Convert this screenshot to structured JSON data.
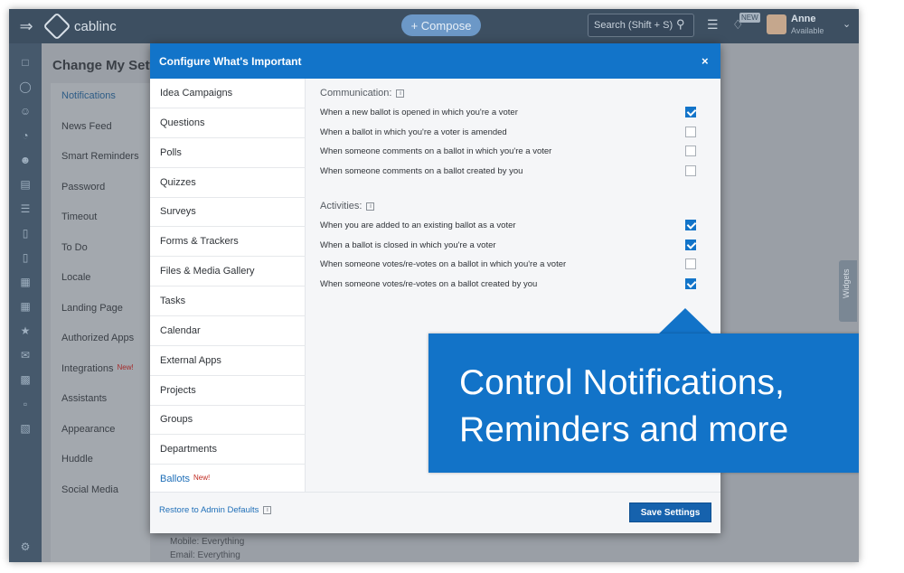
{
  "app": {
    "logo_text": "cablinc",
    "compose_label": "+ Compose",
    "search_placeholder": "Search (Shift + S)",
    "new_badge": "NEW",
    "user_name": "Anne",
    "user_status": "Available",
    "widgets_label": "Widgets"
  },
  "page": {
    "title": "Change My Setti",
    "settings_nav": [
      {
        "label": "Notifications",
        "active": true
      },
      {
        "label": "News Feed"
      },
      {
        "label": "Smart Reminders"
      },
      {
        "label": "Password"
      },
      {
        "label": "Timeout"
      },
      {
        "label": "To Do"
      },
      {
        "label": "Locale"
      },
      {
        "label": "Landing Page"
      },
      {
        "label": "Authorized Apps"
      },
      {
        "label": "Integrations",
        "badge": "New!"
      },
      {
        "label": "Assistants"
      },
      {
        "label": "Appearance"
      },
      {
        "label": "Huddle"
      },
      {
        "label": "Social Media"
      }
    ],
    "footer_lines": [
      "Mobile: Everything",
      "Email: Everything"
    ]
  },
  "modal": {
    "title": "Configure What's Important",
    "close_glyph": "×",
    "categories": [
      {
        "label": "Idea Campaigns"
      },
      {
        "label": "Questions"
      },
      {
        "label": "Polls"
      },
      {
        "label": "Quizzes"
      },
      {
        "label": "Surveys"
      },
      {
        "label": "Forms & Trackers"
      },
      {
        "label": "Files & Media Gallery"
      },
      {
        "label": "Tasks"
      },
      {
        "label": "Calendar"
      },
      {
        "label": "External Apps"
      },
      {
        "label": "Projects"
      },
      {
        "label": "Groups"
      },
      {
        "label": "Departments"
      },
      {
        "label": "Ballots",
        "badge": "New!",
        "active": true
      }
    ],
    "sections": [
      {
        "title": "Communication:",
        "options": [
          {
            "label": "When a new ballot is opened in which you're a voter",
            "checked": true
          },
          {
            "label": "When a ballot in which you're a voter is amended",
            "checked": false
          },
          {
            "label": "When someone comments on a ballot in which you're a voter",
            "checked": false
          },
          {
            "label": "When someone comments on a ballot created by you",
            "checked": false
          }
        ]
      },
      {
        "title": "Activities:",
        "options": [
          {
            "label": "When you are added to an existing ballot as a voter",
            "checked": true
          },
          {
            "label": "When a ballot is closed in which you're a voter",
            "checked": true
          },
          {
            "label": "When someone votes/re-votes on a ballot in which you're a voter",
            "checked": false
          },
          {
            "label": "When someone votes/re-votes on a ballot created by you",
            "checked": true
          }
        ]
      }
    ],
    "restore_label": "Restore to Admin Defaults",
    "info_glyph": "i",
    "save_label": "Save Settings"
  },
  "callout": {
    "line1": "Control Notifications,",
    "line2": "Reminders and more"
  },
  "colors": {
    "accent": "#1274c9",
    "topbar": "#3d4f61",
    "badge_red": "#c0281f"
  }
}
